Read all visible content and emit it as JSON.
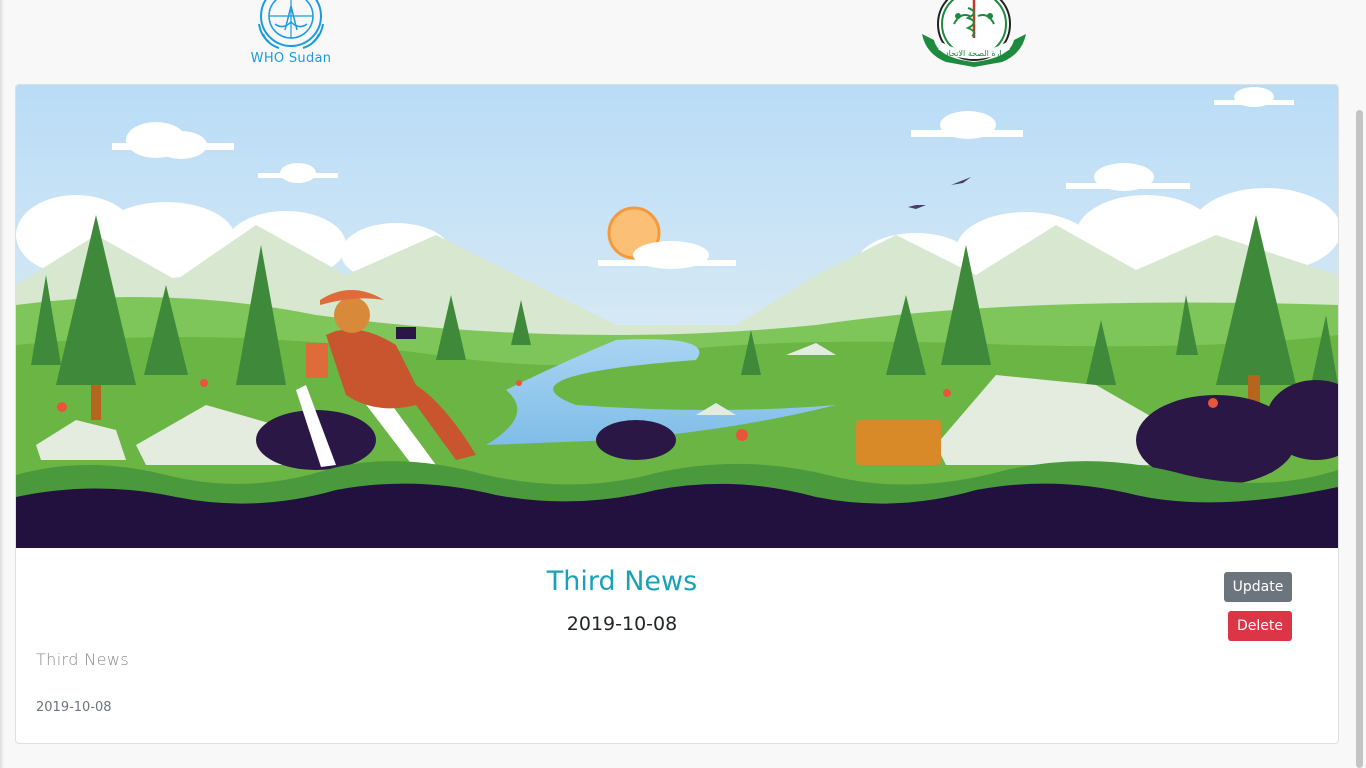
{
  "header": {
    "who_logo_text": "WHO Sudan",
    "moh_logo_caption": "وزارة الصحة الاتحادية"
  },
  "news": {
    "title": "Third News",
    "date": "2019-10-08",
    "body": "Third News",
    "small_date": "2019-10-08"
  },
  "actions": {
    "update_label": "Update",
    "delete_label": "Delete"
  },
  "colors": {
    "title": "#17a2b8",
    "update_button": "#6c757d",
    "delete_button": "#dc3545",
    "who_blue": "#1a9be0"
  },
  "icons": {
    "who": "who-emblem-icon",
    "moh": "ministry-of-health-emblem-icon"
  }
}
